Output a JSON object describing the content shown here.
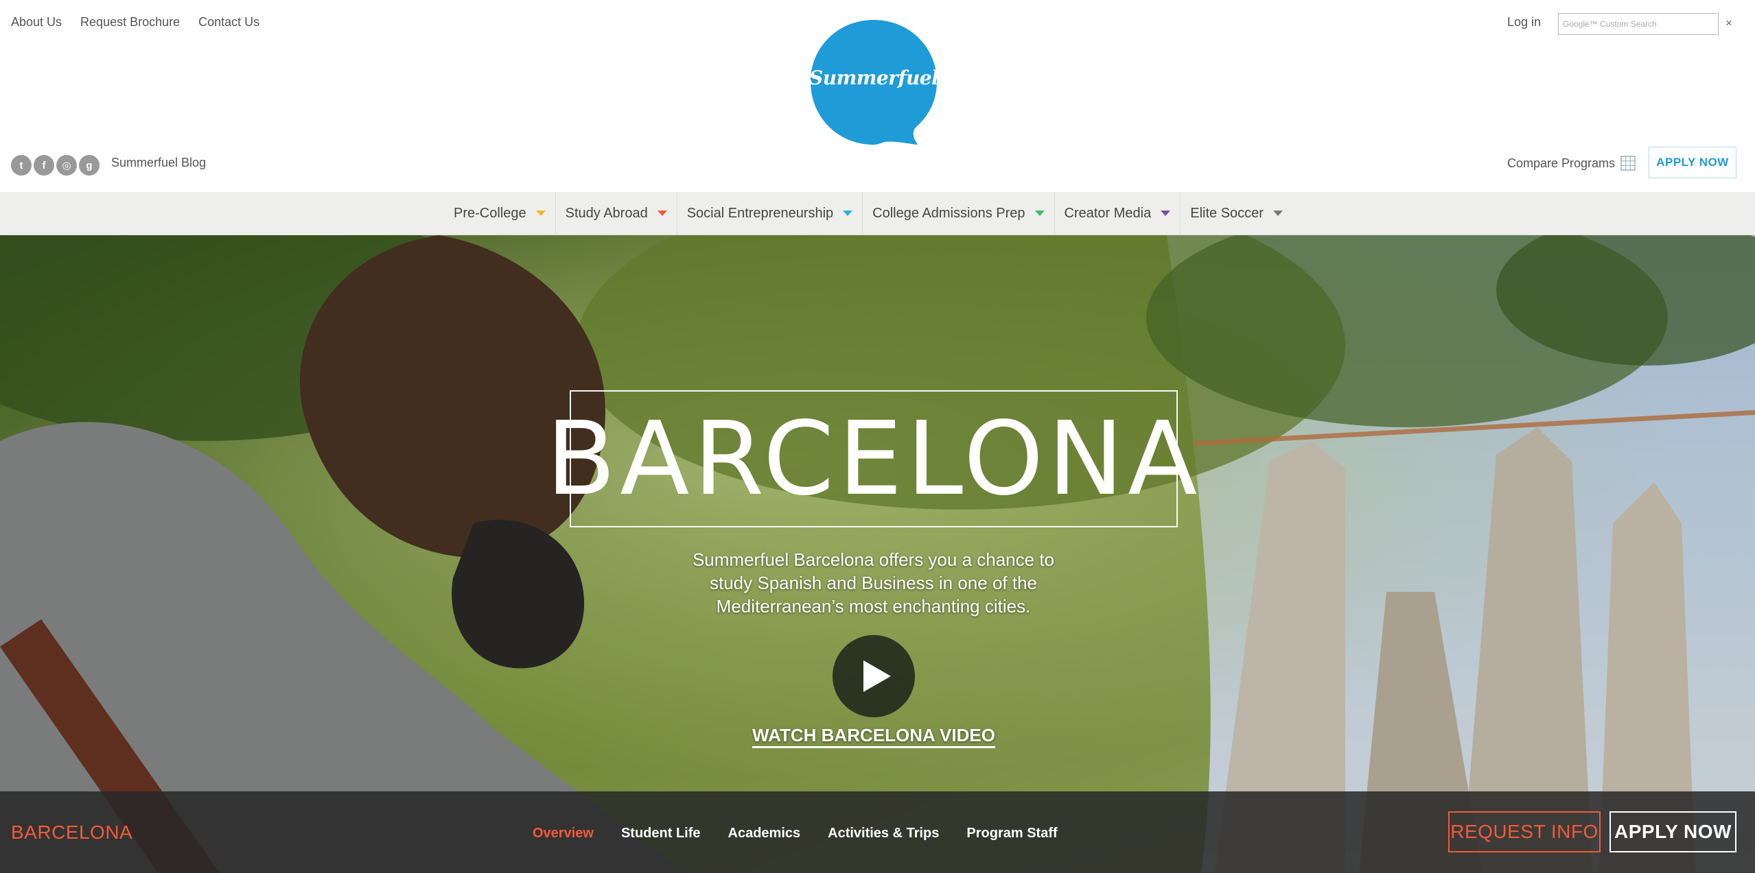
{
  "colors": {
    "brand_blue": "#1f9cd8",
    "accent_orange": "#f25a3a",
    "nav_bg": "#eeeeec",
    "subnav_bg": "#282828"
  },
  "header": {
    "util_links": [
      "About Us",
      "Request Brochure",
      "Contact Us"
    ],
    "logo_text": "Summerfuel",
    "login_label": "Log in",
    "search": {
      "placeholder": "Google™ Custom Search",
      "value": ""
    },
    "search_clear": "×",
    "social": [
      {
        "name": "twitter-icon",
        "glyph": "t"
      },
      {
        "name": "facebook-icon",
        "glyph": "f"
      },
      {
        "name": "instagram-icon",
        "glyph": "◎"
      },
      {
        "name": "google-plus-icon",
        "glyph": "g"
      }
    ],
    "blog_label": "Summerfuel Blog",
    "compare_label": "Compare Programs",
    "apply_label": "APPLY NOW"
  },
  "main_nav": {
    "items": [
      {
        "label": "Pre-College",
        "caret_color": "#f4b72a"
      },
      {
        "label": "Study Abroad",
        "caret_color": "#f25a3a"
      },
      {
        "label": "Social Entrepreneurship",
        "caret_color": "#27b4d6"
      },
      {
        "label": "College Admissions Prep",
        "caret_color": "#3cbf5a"
      },
      {
        "label": "Creator Media",
        "caret_color": "#7a4ea6"
      },
      {
        "label": "Elite Soccer",
        "caret_color": "#777777"
      }
    ]
  },
  "hero": {
    "title": "BARCELONA",
    "description": "Summerfuel Barcelona offers you a chance to study Spanish and Business in one of the Mediterranean’s most enchanting cities.",
    "video_link": "WATCH BARCELONA VIDEO"
  },
  "subnav": {
    "title": "BARCELONA",
    "tabs": [
      {
        "label": "Overview",
        "active": true
      },
      {
        "label": "Student Life",
        "active": false
      },
      {
        "label": "Academics",
        "active": false
      },
      {
        "label": "Activities & Trips",
        "active": false
      },
      {
        "label": "Program Staff",
        "active": false
      }
    ],
    "request_label": "REQUEST INFO",
    "apply_label": "APPLY NOW"
  }
}
